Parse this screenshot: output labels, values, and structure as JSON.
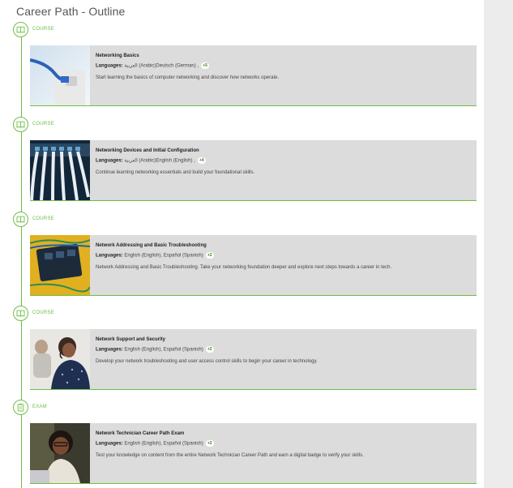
{
  "page": {
    "title": "Career Path - Outline"
  },
  "items": [
    {
      "type": "COURSE",
      "title": "Networking Basics",
      "languages_label": "Languages:",
      "languages": "العربية (Arabic)Deutsch (German) ,",
      "more": "+5",
      "description": "Start learning the basics of computer networking and discover how networks operate."
    },
    {
      "type": "COURSE",
      "title": "Networking Devices and Initial Configuration",
      "languages_label": "Languages:",
      "languages": "العربية (Arabic)English (English) ,",
      "more": "+4",
      "description": "Continue learning networking essentials and build your foundational skills."
    },
    {
      "type": "COURSE",
      "title": "Network Addressing and Basic Troubleshooting",
      "languages_label": "Languages:",
      "languages": "English (English), Español (Spanish)",
      "more": "+2",
      "description": "Network Addressing and Basic Troubleshooting. Take your networking foundation deeper and explore next steps towards a career in tech."
    },
    {
      "type": "COURSE",
      "title": "Network Support and Security",
      "languages_label": "Languages:",
      "languages": "English (English), Español (Spanish)",
      "more": "+2",
      "description": "Develop your network troubleshooting and user access control skills to begin your career in technology."
    },
    {
      "type": "EXAM",
      "title": "Network Technician Career Path Exam",
      "languages_label": "Languages:",
      "languages": "English (English), Español (Spanish)",
      "more": "+2",
      "description": "Test your knowledge on content from the entire Network Technician Career Path and earn a digital badge to verify your skills."
    }
  ],
  "colors": {
    "accent": "#6ebe44",
    "card_bg": "#dcdcdc",
    "side_panel": "#ececec"
  },
  "icons": [
    "book-icon",
    "book-icon",
    "book-icon",
    "book-icon",
    "clipboard-icon"
  ]
}
